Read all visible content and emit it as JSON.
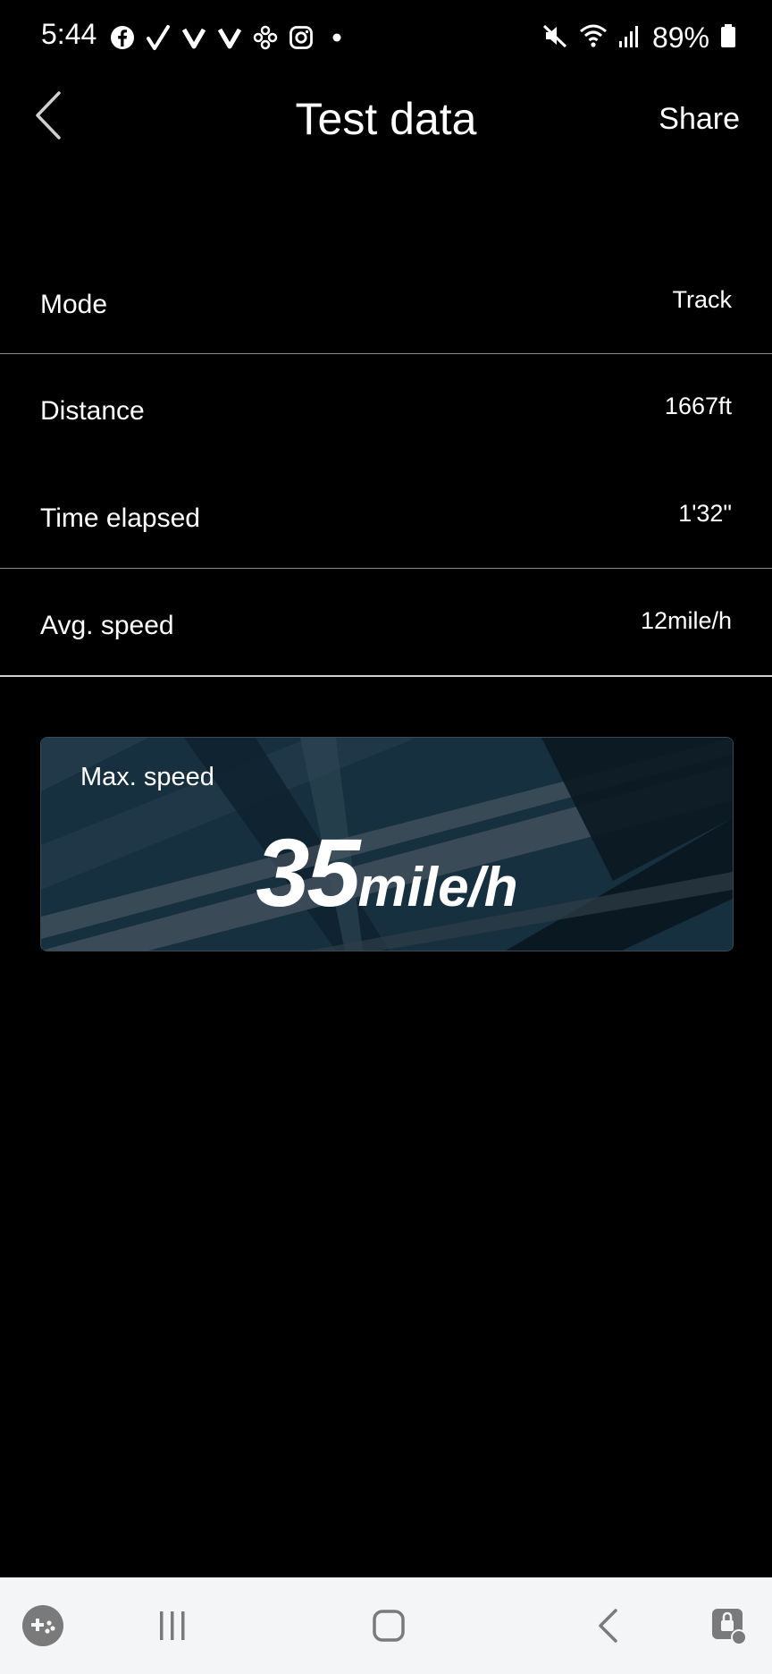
{
  "status_bar": {
    "time": "5:44",
    "battery_percent": "89%",
    "left_icons": [
      "facebook-icon",
      "check-icon",
      "v-icon",
      "v-icon",
      "game-pad-icon",
      "instagram-icon",
      "dot-icon"
    ],
    "right_icons": [
      "mute-icon",
      "wifi-icon",
      "signal-icon",
      "battery-icon"
    ]
  },
  "header": {
    "title": "Test data",
    "share_label": "Share"
  },
  "rows": [
    {
      "label": "Mode",
      "value": "Track"
    },
    {
      "label": "Distance",
      "value": "1667ft"
    },
    {
      "label": "Time elapsed",
      "value": "1'32\""
    },
    {
      "label": "Avg. speed",
      "value": "12mile/h"
    }
  ],
  "max_speed": {
    "label": "Max. speed",
    "value": "35",
    "unit": "mile/h"
  },
  "colors": {
    "background": "#000000",
    "card_background": "#15252f",
    "nav_background": "#f4f5f7",
    "nav_icon": "#7a7a7a"
  }
}
